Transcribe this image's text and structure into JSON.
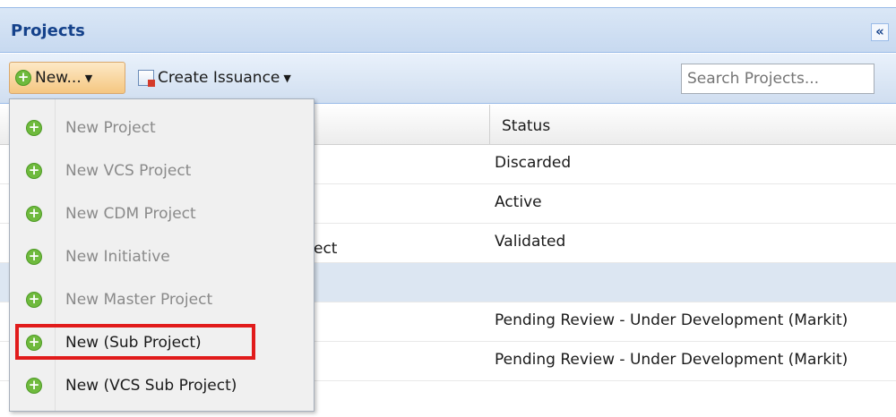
{
  "panel": {
    "title": "Projects",
    "collapse_icon": "«"
  },
  "toolbar": {
    "new_label": "New...",
    "create_issuance_label": "Create Issuance",
    "search_placeholder": "Search Projects..."
  },
  "grid": {
    "status_header": "Status",
    "rows": [
      {
        "name_fragment": "",
        "status": "Discarded"
      },
      {
        "name_fragment": "",
        "status": "Active"
      },
      {
        "name_fragment": "ect",
        "status": "Validated"
      },
      {
        "name_fragment": "",
        "status": ""
      },
      {
        "name_fragment": "",
        "status": "Pending Review - Under Development (Markit)"
      },
      {
        "name_fragment": "",
        "status": "Pending Review - Under Development (Markit)"
      }
    ]
  },
  "menu": {
    "items": [
      {
        "label": "New Project",
        "enabled": false
      },
      {
        "label": "New VCS Project",
        "enabled": false
      },
      {
        "label": "New CDM Project",
        "enabled": false
      },
      {
        "label": "New Initiative",
        "enabled": false
      },
      {
        "label": "New Master Project",
        "enabled": false
      },
      {
        "label": "New (Sub Project)",
        "enabled": true
      },
      {
        "label": "New (VCS Sub Project)",
        "enabled": true
      }
    ]
  },
  "colors": {
    "highlight": "#e11b1b",
    "accent": "#15428b",
    "plus_icon": "#6fba3d"
  }
}
